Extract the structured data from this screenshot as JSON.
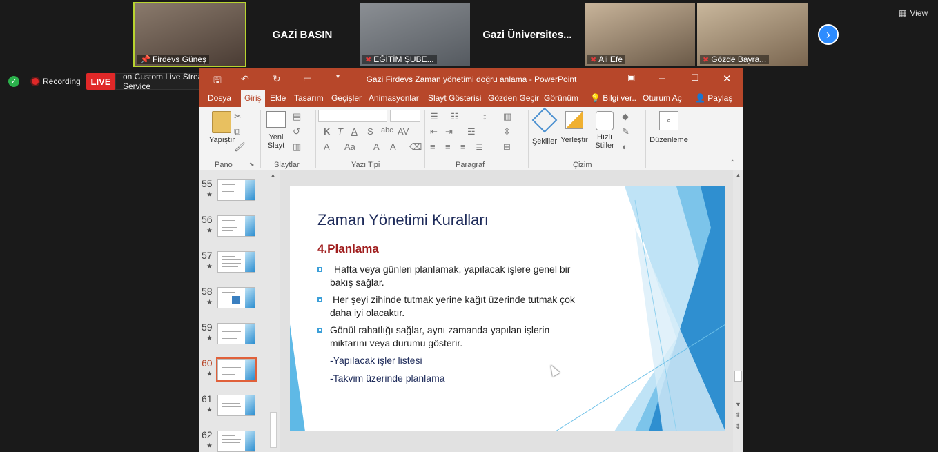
{
  "participants": [
    {
      "name": "Firdevs Güneş",
      "type": "video",
      "active": true
    },
    {
      "name": "GAZİ BASIN",
      "type": "name"
    },
    {
      "name": "EĞİTİM ŞUBE...",
      "type": "video"
    },
    {
      "name": "Gazi Üniversites...",
      "type": "name"
    },
    {
      "name": "Ali Efe",
      "type": "video"
    },
    {
      "name": "Gözde Bayra...",
      "type": "video"
    }
  ],
  "view_label": "View",
  "status": {
    "recording": "Recording",
    "live": "LIVE",
    "stream": "on Custom Live Streaming Service"
  },
  "ppt": {
    "title": "Gazi Firdevs Zaman yönetimi doğru anlama - PowerPoint",
    "tabs": [
      "Dosya",
      "Giriş",
      "Ekle",
      "Tasarım",
      "Geçişler",
      "Animasyonlar",
      "Slayt Gösterisi",
      "Gözden Geçir",
      "Görünüm",
      "Bilgi ver..",
      "Oturum Aç",
      "Paylaş"
    ],
    "ribbon": {
      "paste": "Yapıştır",
      "new_slide": "Yeni\nSlayt",
      "new_slide_1": "Yeni",
      "new_slide_2": "Slayt",
      "shapes": "Şekiller",
      "arrange": "Yerleştir",
      "quick_styles_1": "Hızlı",
      "quick_styles_2": "Stiller",
      "editing": "Düzenleme",
      "groups": [
        "Pano",
        "Slaytlar",
        "Yazı Tipi",
        "Paragraf",
        "Çizim"
      ]
    },
    "slide_numbers": [
      "55",
      "56",
      "57",
      "58",
      "59",
      "60",
      "61",
      "62"
    ],
    "current_slide": "60",
    "slide": {
      "title": "Zaman Yönetimi Kuralları",
      "heading": "4.Planlama",
      "bullets": [
        [
          "Hafta veya  günleri planlamak, yapılacak işlere genel bir",
          "bakış sağlar."
        ],
        [
          "Her şeyi zihinde tutmak yerine  kağıt üzerinde tutmak çok",
          "daha iyi olacaktır."
        ],
        [
          "Gönül rahatlığı sağlar, aynı zamanda yapılan işlerin",
          "miktarını veya durumu gösterir."
        ]
      ],
      "subitems": [
        "-Yapılacak işler listesi",
        "-Takvim üzerinde  planlama"
      ]
    }
  }
}
